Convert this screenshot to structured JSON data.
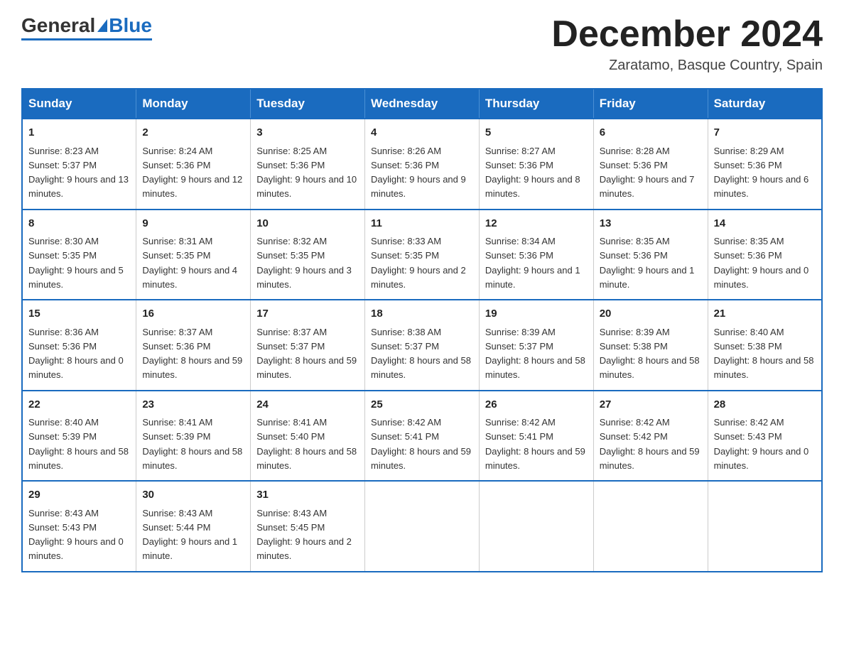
{
  "logo": {
    "general": "General",
    "blue": "Blue"
  },
  "title": "December 2024",
  "subtitle": "Zaratamo, Basque Country, Spain",
  "days_of_week": [
    "Sunday",
    "Monday",
    "Tuesday",
    "Wednesday",
    "Thursday",
    "Friday",
    "Saturday"
  ],
  "weeks": [
    [
      {
        "day": "1",
        "sunrise": "8:23 AM",
        "sunset": "5:37 PM",
        "daylight": "9 hours and 13 minutes."
      },
      {
        "day": "2",
        "sunrise": "8:24 AM",
        "sunset": "5:36 PM",
        "daylight": "9 hours and 12 minutes."
      },
      {
        "day": "3",
        "sunrise": "8:25 AM",
        "sunset": "5:36 PM",
        "daylight": "9 hours and 10 minutes."
      },
      {
        "day": "4",
        "sunrise": "8:26 AM",
        "sunset": "5:36 PM",
        "daylight": "9 hours and 9 minutes."
      },
      {
        "day": "5",
        "sunrise": "8:27 AM",
        "sunset": "5:36 PM",
        "daylight": "9 hours and 8 minutes."
      },
      {
        "day": "6",
        "sunrise": "8:28 AM",
        "sunset": "5:36 PM",
        "daylight": "9 hours and 7 minutes."
      },
      {
        "day": "7",
        "sunrise": "8:29 AM",
        "sunset": "5:36 PM",
        "daylight": "9 hours and 6 minutes."
      }
    ],
    [
      {
        "day": "8",
        "sunrise": "8:30 AM",
        "sunset": "5:35 PM",
        "daylight": "9 hours and 5 minutes."
      },
      {
        "day": "9",
        "sunrise": "8:31 AM",
        "sunset": "5:35 PM",
        "daylight": "9 hours and 4 minutes."
      },
      {
        "day": "10",
        "sunrise": "8:32 AM",
        "sunset": "5:35 PM",
        "daylight": "9 hours and 3 minutes."
      },
      {
        "day": "11",
        "sunrise": "8:33 AM",
        "sunset": "5:35 PM",
        "daylight": "9 hours and 2 minutes."
      },
      {
        "day": "12",
        "sunrise": "8:34 AM",
        "sunset": "5:36 PM",
        "daylight": "9 hours and 1 minute."
      },
      {
        "day": "13",
        "sunrise": "8:35 AM",
        "sunset": "5:36 PM",
        "daylight": "9 hours and 1 minute."
      },
      {
        "day": "14",
        "sunrise": "8:35 AM",
        "sunset": "5:36 PM",
        "daylight": "9 hours and 0 minutes."
      }
    ],
    [
      {
        "day": "15",
        "sunrise": "8:36 AM",
        "sunset": "5:36 PM",
        "daylight": "8 hours and 0 minutes."
      },
      {
        "day": "16",
        "sunrise": "8:37 AM",
        "sunset": "5:36 PM",
        "daylight": "8 hours and 59 minutes."
      },
      {
        "day": "17",
        "sunrise": "8:37 AM",
        "sunset": "5:37 PM",
        "daylight": "8 hours and 59 minutes."
      },
      {
        "day": "18",
        "sunrise": "8:38 AM",
        "sunset": "5:37 PM",
        "daylight": "8 hours and 58 minutes."
      },
      {
        "day": "19",
        "sunrise": "8:39 AM",
        "sunset": "5:37 PM",
        "daylight": "8 hours and 58 minutes."
      },
      {
        "day": "20",
        "sunrise": "8:39 AM",
        "sunset": "5:38 PM",
        "daylight": "8 hours and 58 minutes."
      },
      {
        "day": "21",
        "sunrise": "8:40 AM",
        "sunset": "5:38 PM",
        "daylight": "8 hours and 58 minutes."
      }
    ],
    [
      {
        "day": "22",
        "sunrise": "8:40 AM",
        "sunset": "5:39 PM",
        "daylight": "8 hours and 58 minutes."
      },
      {
        "day": "23",
        "sunrise": "8:41 AM",
        "sunset": "5:39 PM",
        "daylight": "8 hours and 58 minutes."
      },
      {
        "day": "24",
        "sunrise": "8:41 AM",
        "sunset": "5:40 PM",
        "daylight": "8 hours and 58 minutes."
      },
      {
        "day": "25",
        "sunrise": "8:42 AM",
        "sunset": "5:41 PM",
        "daylight": "8 hours and 59 minutes."
      },
      {
        "day": "26",
        "sunrise": "8:42 AM",
        "sunset": "5:41 PM",
        "daylight": "8 hours and 59 minutes."
      },
      {
        "day": "27",
        "sunrise": "8:42 AM",
        "sunset": "5:42 PM",
        "daylight": "8 hours and 59 minutes."
      },
      {
        "day": "28",
        "sunrise": "8:42 AM",
        "sunset": "5:43 PM",
        "daylight": "9 hours and 0 minutes."
      }
    ],
    [
      {
        "day": "29",
        "sunrise": "8:43 AM",
        "sunset": "5:43 PM",
        "daylight": "9 hours and 0 minutes."
      },
      {
        "day": "30",
        "sunrise": "8:43 AM",
        "sunset": "5:44 PM",
        "daylight": "9 hours and 1 minute."
      },
      {
        "day": "31",
        "sunrise": "8:43 AM",
        "sunset": "5:45 PM",
        "daylight": "9 hours and 2 minutes."
      },
      null,
      null,
      null,
      null
    ]
  ]
}
